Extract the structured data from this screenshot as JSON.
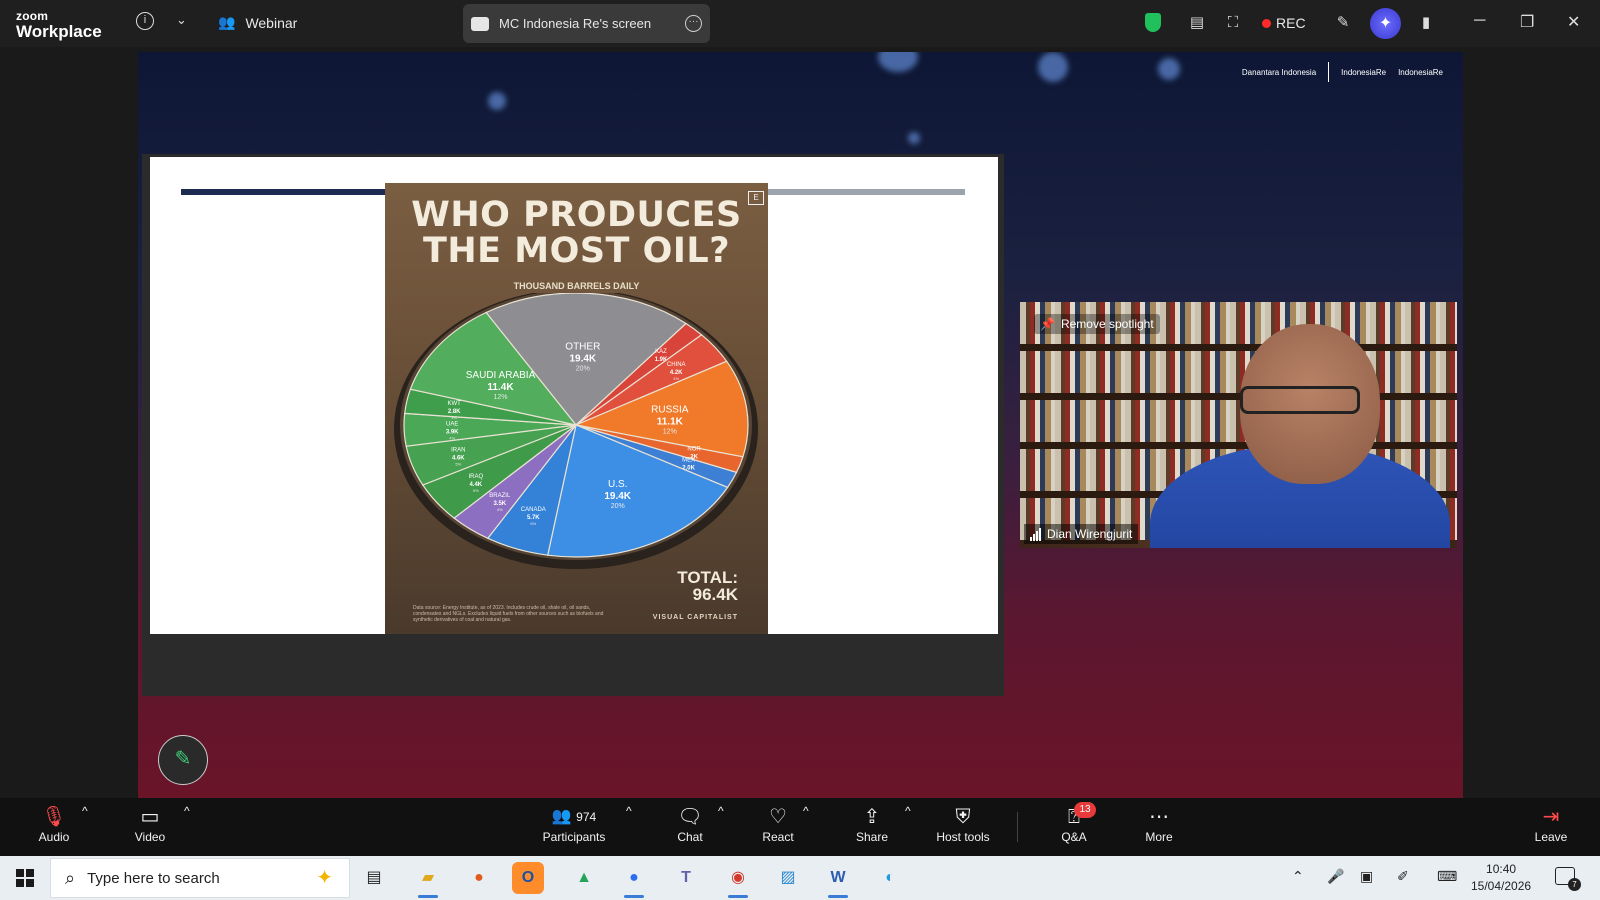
{
  "titlebar": {
    "brand_top": "zoom",
    "brand_bottom": "Workplace",
    "webinar_label": "Webinar",
    "shared_screen_label": "MC Indonesia Re's screen",
    "rec_label": "REC"
  },
  "stage": {
    "partner_logos": [
      "Danantara Indonesia",
      "IndonesiaRe",
      "IndonesiaRe"
    ]
  },
  "slide": {
    "title": "WHO PRODUCES THE MOST OIL?",
    "subtitle": "THOUSAND BARRELS DAILY",
    "badge": "E",
    "total_label": "TOTAL:",
    "total_value": "96.4K",
    "footer_text": "Data source: Energy Institute, as of 2023. Includes crude oil, shale oil, oil sands, condensates and NGLs. Excludes liquid fuels from other sources such as biofuels and synthetic derivatives of coal and natural gas.",
    "brand": "VISUAL CAPITALIST"
  },
  "chart_data": {
    "type": "pie",
    "title": "WHO PRODUCES THE MOST OIL?",
    "subtitle": "THOUSAND BARRELS DAILY",
    "slices": [
      {
        "label": "OTHER",
        "value_text": "19.4K",
        "share": "20%",
        "color": "#8e8e92"
      },
      {
        "label": "KAZ",
        "value_text": "1.9K",
        "share": "2%",
        "color": "#d9443a"
      },
      {
        "label": "CHINA",
        "value_text": "4.2K",
        "share": "4%",
        "color": "#e0503c"
      },
      {
        "label": "RUSSIA",
        "value_text": "11.1K",
        "share": "12%",
        "color": "#f07a2a"
      },
      {
        "label": "NOR",
        "value_text": "2K",
        "share": "2%",
        "color": "#e8662e"
      },
      {
        "label": "MEX",
        "value_text": "2.0K",
        "share": "2%",
        "color": "#3c7fd4"
      },
      {
        "label": "U.S.",
        "value_text": "19.4K",
        "share": "20%",
        "color": "#3d8fe6"
      },
      {
        "label": "CANADA",
        "value_text": "5.7K",
        "share": "6%",
        "color": "#3481d8"
      },
      {
        "label": "BRAZIL",
        "value_text": "3.5K",
        "share": "4%",
        "color": "#8c6fc0"
      },
      {
        "label": "IRAQ",
        "value_text": "4.4K",
        "share": "5%",
        "color": "#3f9a4a"
      },
      {
        "label": "IRAN",
        "value_text": "4.6K",
        "share": "5%",
        "color": "#46a250"
      },
      {
        "label": "UAE",
        "value_text": "3.9K",
        "share": "4%",
        "color": "#4aa856"
      },
      {
        "label": "KWT",
        "value_text": "2.8K",
        "share": "3%",
        "color": "#3f9e4c"
      },
      {
        "label": "SAUDI ARABIA",
        "value_text": "11.4K",
        "share": "12%",
        "color": "#52ad5c"
      }
    ],
    "total": "96.4K"
  },
  "video": {
    "spotlight_label": "Remove spotlight",
    "participant_name": "Dian Wirengjurit"
  },
  "toolbar": {
    "audio": "Audio",
    "video": "Video",
    "participants": "Participants",
    "participants_count": "974",
    "chat": "Chat",
    "react": "React",
    "share": "Share",
    "host_tools": "Host tools",
    "qa": "Q&A",
    "qa_badge": "13",
    "more": "More",
    "leave": "Leave"
  },
  "taskbar": {
    "search_placeholder": "Type here to search",
    "time": "10:40",
    "date": "15/04/2026",
    "notification_count": "7"
  },
  "colors": {
    "zoom_accent": "#3a3ad0",
    "rec_red": "#ff2b2b",
    "security_green": "#20c05c",
    "badge_red": "#e83a3a"
  }
}
